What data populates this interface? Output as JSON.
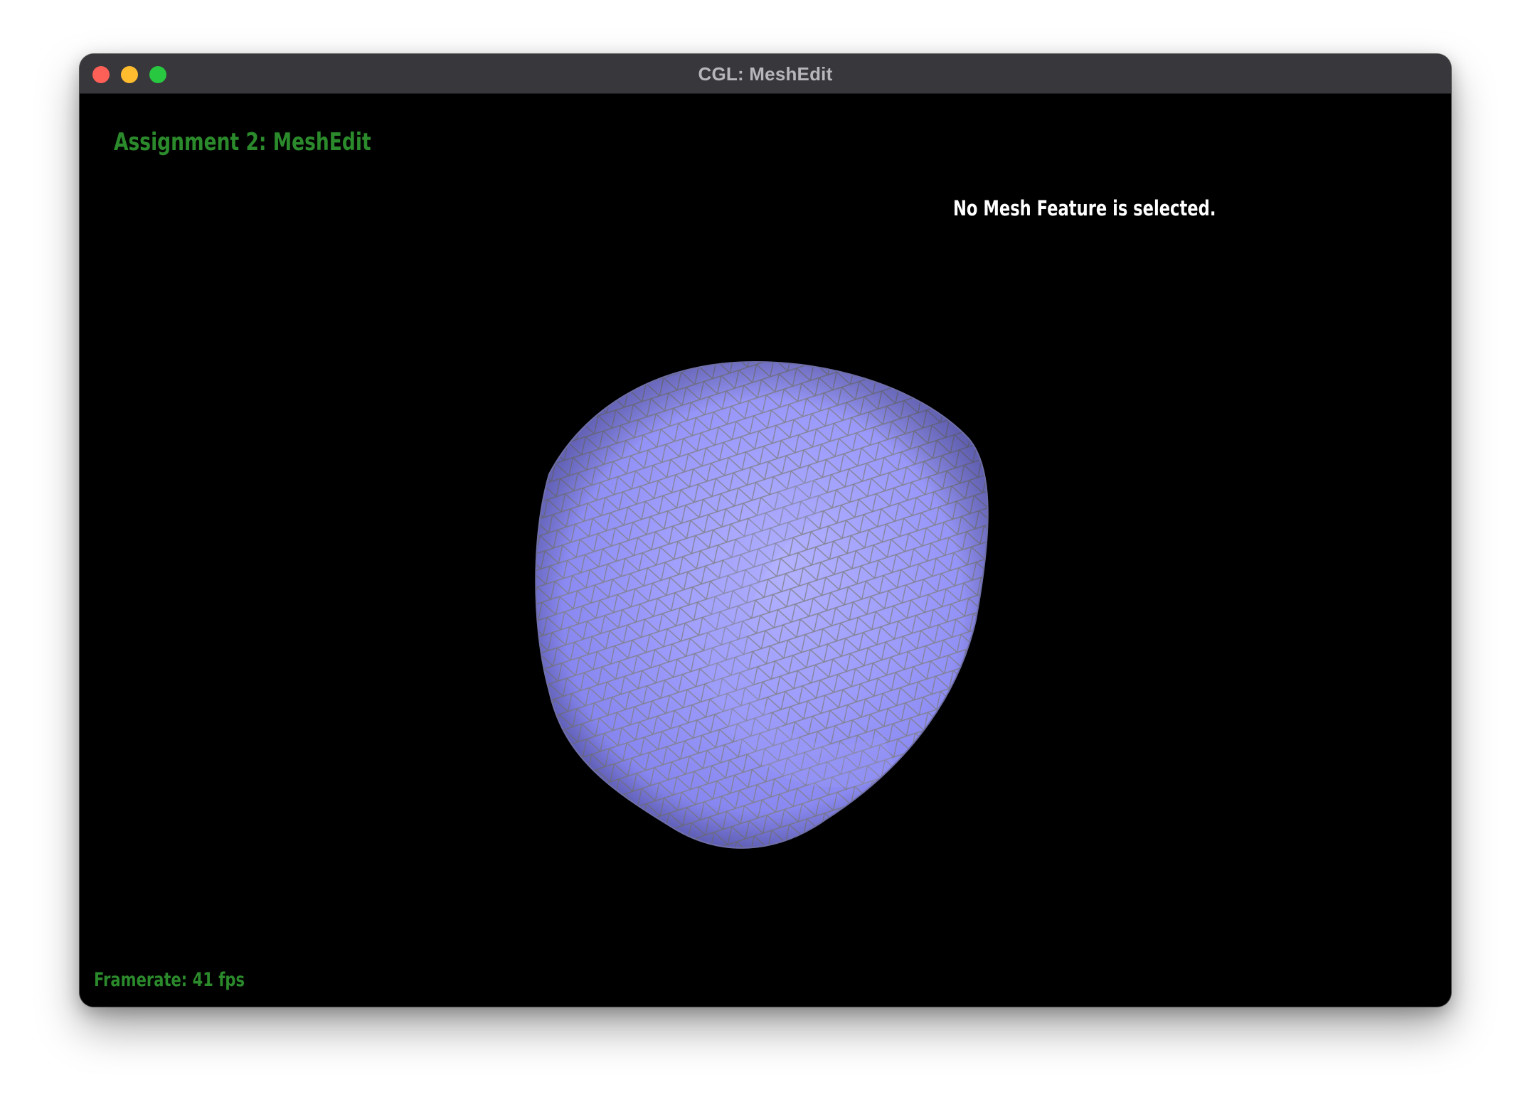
{
  "window": {
    "title": "CGL: MeshEdit",
    "controls": {
      "close_color": "#fe5f57",
      "minimize_color": "#febc2e",
      "maximize_color": "#28c840"
    }
  },
  "hud": {
    "assignment_title": "Assignment 2: MeshEdit",
    "selection_status": "No Mesh Feature is selected.",
    "framerate": "Framerate: 41 fps"
  },
  "colors": {
    "hud_green": "#2b8a2b",
    "mesh_fill": "#8d8cf5",
    "mesh_wire": "#7f7f86",
    "background": "#000000"
  },
  "icons": {
    "close": "close-dot-icon",
    "minimize": "minimize-dot-icon",
    "maximize": "maximize-dot-icon"
  }
}
